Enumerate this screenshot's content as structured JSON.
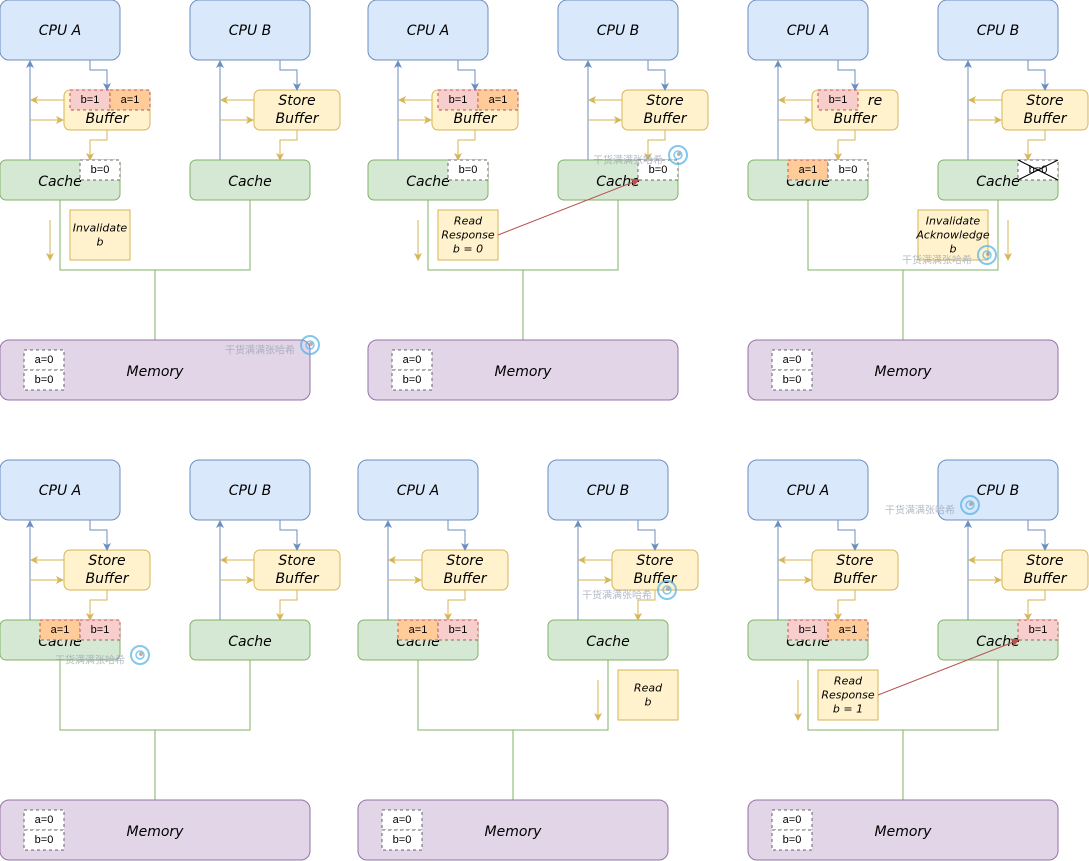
{
  "colors": {
    "cpu_fill": "#dae8fc",
    "cpu_stroke": "#6c8ebf",
    "buffer_fill": "#fff2cc",
    "buffer_stroke": "#d6b656",
    "cache_fill": "#d5e8d4",
    "cache_stroke": "#82b366",
    "memory_fill": "#e1d5e7",
    "memory_stroke": "#9673a6",
    "pink_fill": "#f8cecc",
    "pink_stroke": "#b85450",
    "orange_fill": "#ffcc99",
    "white_fill": "#ffffff",
    "dashed_stroke": "#666666",
    "msg_fill": "#fff2cc",
    "msg_stroke": "#d6b656",
    "red_arrow": "#b85450",
    "watermark": "#9aa3b5",
    "watermark_icon": "#5bb5e8"
  },
  "labels": {
    "cpu_a": "CPU A",
    "cpu_b": "CPU B",
    "store_buffer_line1": "Store",
    "store_buffer_line2": "Buffer",
    "cache": "Cache",
    "memory": "Memory",
    "mem_a": "a=0",
    "mem_b": "b=0"
  },
  "watermark_text": "干货满满张哈希",
  "panels": [
    {
      "id": "panel-1",
      "buffer_a_entries": [
        {
          "text": "b=1",
          "color": "pink"
        },
        {
          "text": "a=1",
          "color": "orange"
        }
      ],
      "buffer_a_label_override": "Buffer",
      "cache_a_entries": [
        {
          "text": "b=0",
          "color": "white"
        }
      ],
      "cache_b_entries": [],
      "message": {
        "lines": [
          "Invalidate",
          "b"
        ],
        "side": "left"
      },
      "watermark": true
    },
    {
      "id": "panel-2",
      "buffer_a_entries": [
        {
          "text": "b=1",
          "color": "pink"
        },
        {
          "text": "a=1",
          "color": "orange"
        }
      ],
      "buffer_a_label_override": "Buffer",
      "cache_a_entries": [
        {
          "text": "b=0",
          "color": "white"
        }
      ],
      "cache_b_entries": [
        {
          "text": "b=0",
          "color": "white"
        }
      ],
      "message": {
        "lines": [
          "Read",
          "Response",
          "b = 0"
        ],
        "side": "left",
        "arrow_to_cache_b": true
      },
      "watermark": true
    },
    {
      "id": "panel-3",
      "buffer_a_entries": [
        {
          "text": "b=1",
          "color": "pink"
        }
      ],
      "buffer_a_label_override": "re|Buffer",
      "cache_a_entries": [
        {
          "text": "a=1",
          "color": "orange"
        },
        {
          "text": "b=0",
          "color": "white"
        }
      ],
      "cache_b_entries": [
        {
          "text": "b=0",
          "color": "white",
          "crossed": true
        }
      ],
      "message": {
        "lines": [
          "Invalidate",
          "Acknowledge",
          "b"
        ],
        "side": "right"
      },
      "watermark": true
    },
    {
      "id": "panel-4",
      "buffer_a_entries": [],
      "cache_a_entries": [
        {
          "text": "a=1",
          "color": "orange"
        },
        {
          "text": "b=1",
          "color": "pink"
        }
      ],
      "cache_b_entries": [],
      "message": null,
      "watermark": true
    },
    {
      "id": "panel-5",
      "buffer_a_entries": [],
      "cache_a_entries": [
        {
          "text": "a=1",
          "color": "orange"
        },
        {
          "text": "b=1",
          "color": "pink"
        }
      ],
      "cache_b_entries": [],
      "message": {
        "lines": [
          "Read",
          "b"
        ],
        "side": "right-outer"
      },
      "watermark": true
    },
    {
      "id": "panel-6",
      "buffer_a_entries": [],
      "cache_a_entries": [
        {
          "text": "b=1",
          "color": "pink"
        },
        {
          "text": "a=1",
          "color": "orange"
        }
      ],
      "cache_b_entries": [
        {
          "text": "b=1",
          "color": "pink"
        }
      ],
      "message": {
        "lines": [
          "Read",
          "Response",
          "b = 1"
        ],
        "side": "left",
        "arrow_to_cache_b": true
      },
      "watermark": true
    }
  ]
}
